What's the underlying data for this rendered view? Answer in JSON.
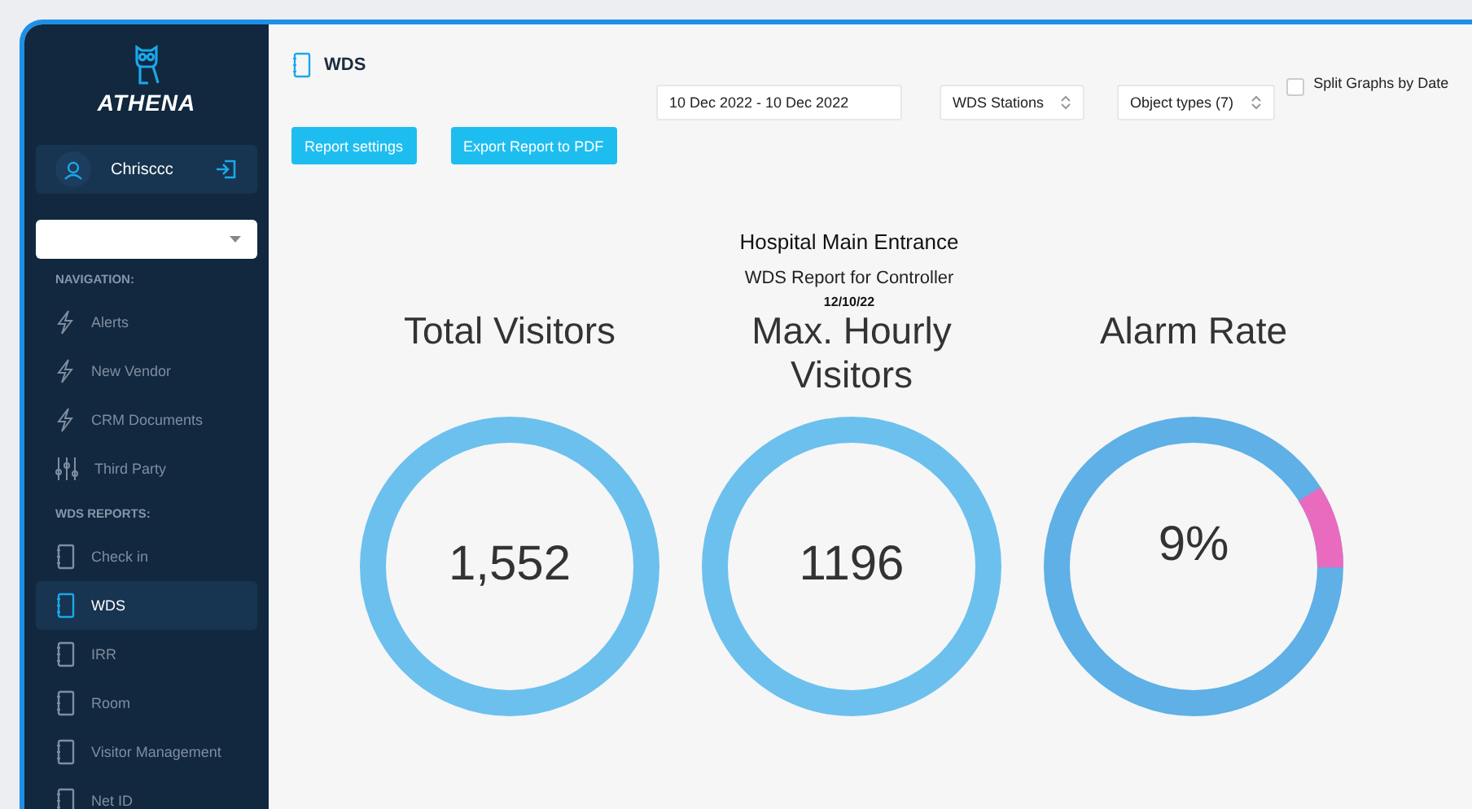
{
  "brand": {
    "name": "ATHENA"
  },
  "user": {
    "name": "Chrisccc"
  },
  "sections": [
    {
      "heading": "NAVIGATION:",
      "items": [
        {
          "label": "Alerts",
          "kind": "bolt",
          "selected": false
        },
        {
          "label": "New Vendor",
          "kind": "bolt",
          "selected": false
        },
        {
          "label": "CRM Documents",
          "kind": "bolt",
          "selected": false
        },
        {
          "label": "Third Party",
          "kind": "sliders",
          "selected": false
        }
      ]
    },
    {
      "heading": "WDS REPORTS:",
      "items": [
        {
          "label": "Check in",
          "kind": "book",
          "selected": false
        },
        {
          "label": "WDS",
          "kind": "book",
          "selected": true
        },
        {
          "label": "IRR",
          "kind": "book",
          "selected": false
        },
        {
          "label": "Room",
          "kind": "book",
          "selected": false
        },
        {
          "label": "Visitor Management",
          "kind": "book",
          "selected": false
        },
        {
          "label": "Net ID",
          "kind": "book",
          "selected": false
        }
      ]
    }
  ],
  "page": {
    "title": "WDS"
  },
  "filters": {
    "date_range": "10 Dec 2022 - 10 Dec 2022",
    "stations": "WDS Stations",
    "object_types": "Object types (7)",
    "split_graphs": {
      "label": "Split Graphs by Date",
      "checked": false
    }
  },
  "buttons": [
    "Report settings",
    "Export Report to PDF"
  ],
  "report": {
    "location": "Hospital Main Entrance",
    "subtitle": "WDS Report for Controller",
    "date": "12/10/22"
  },
  "gauges": [
    {
      "title": "Total Visitors",
      "value": "1,552",
      "kind": "count"
    },
    {
      "title": "Max. Hourly Visitors",
      "value": "1196",
      "kind": "count"
    },
    {
      "title": "Alarm Rate",
      "value": "9%",
      "kind": "rate",
      "level": 0.09
    }
  ]
}
